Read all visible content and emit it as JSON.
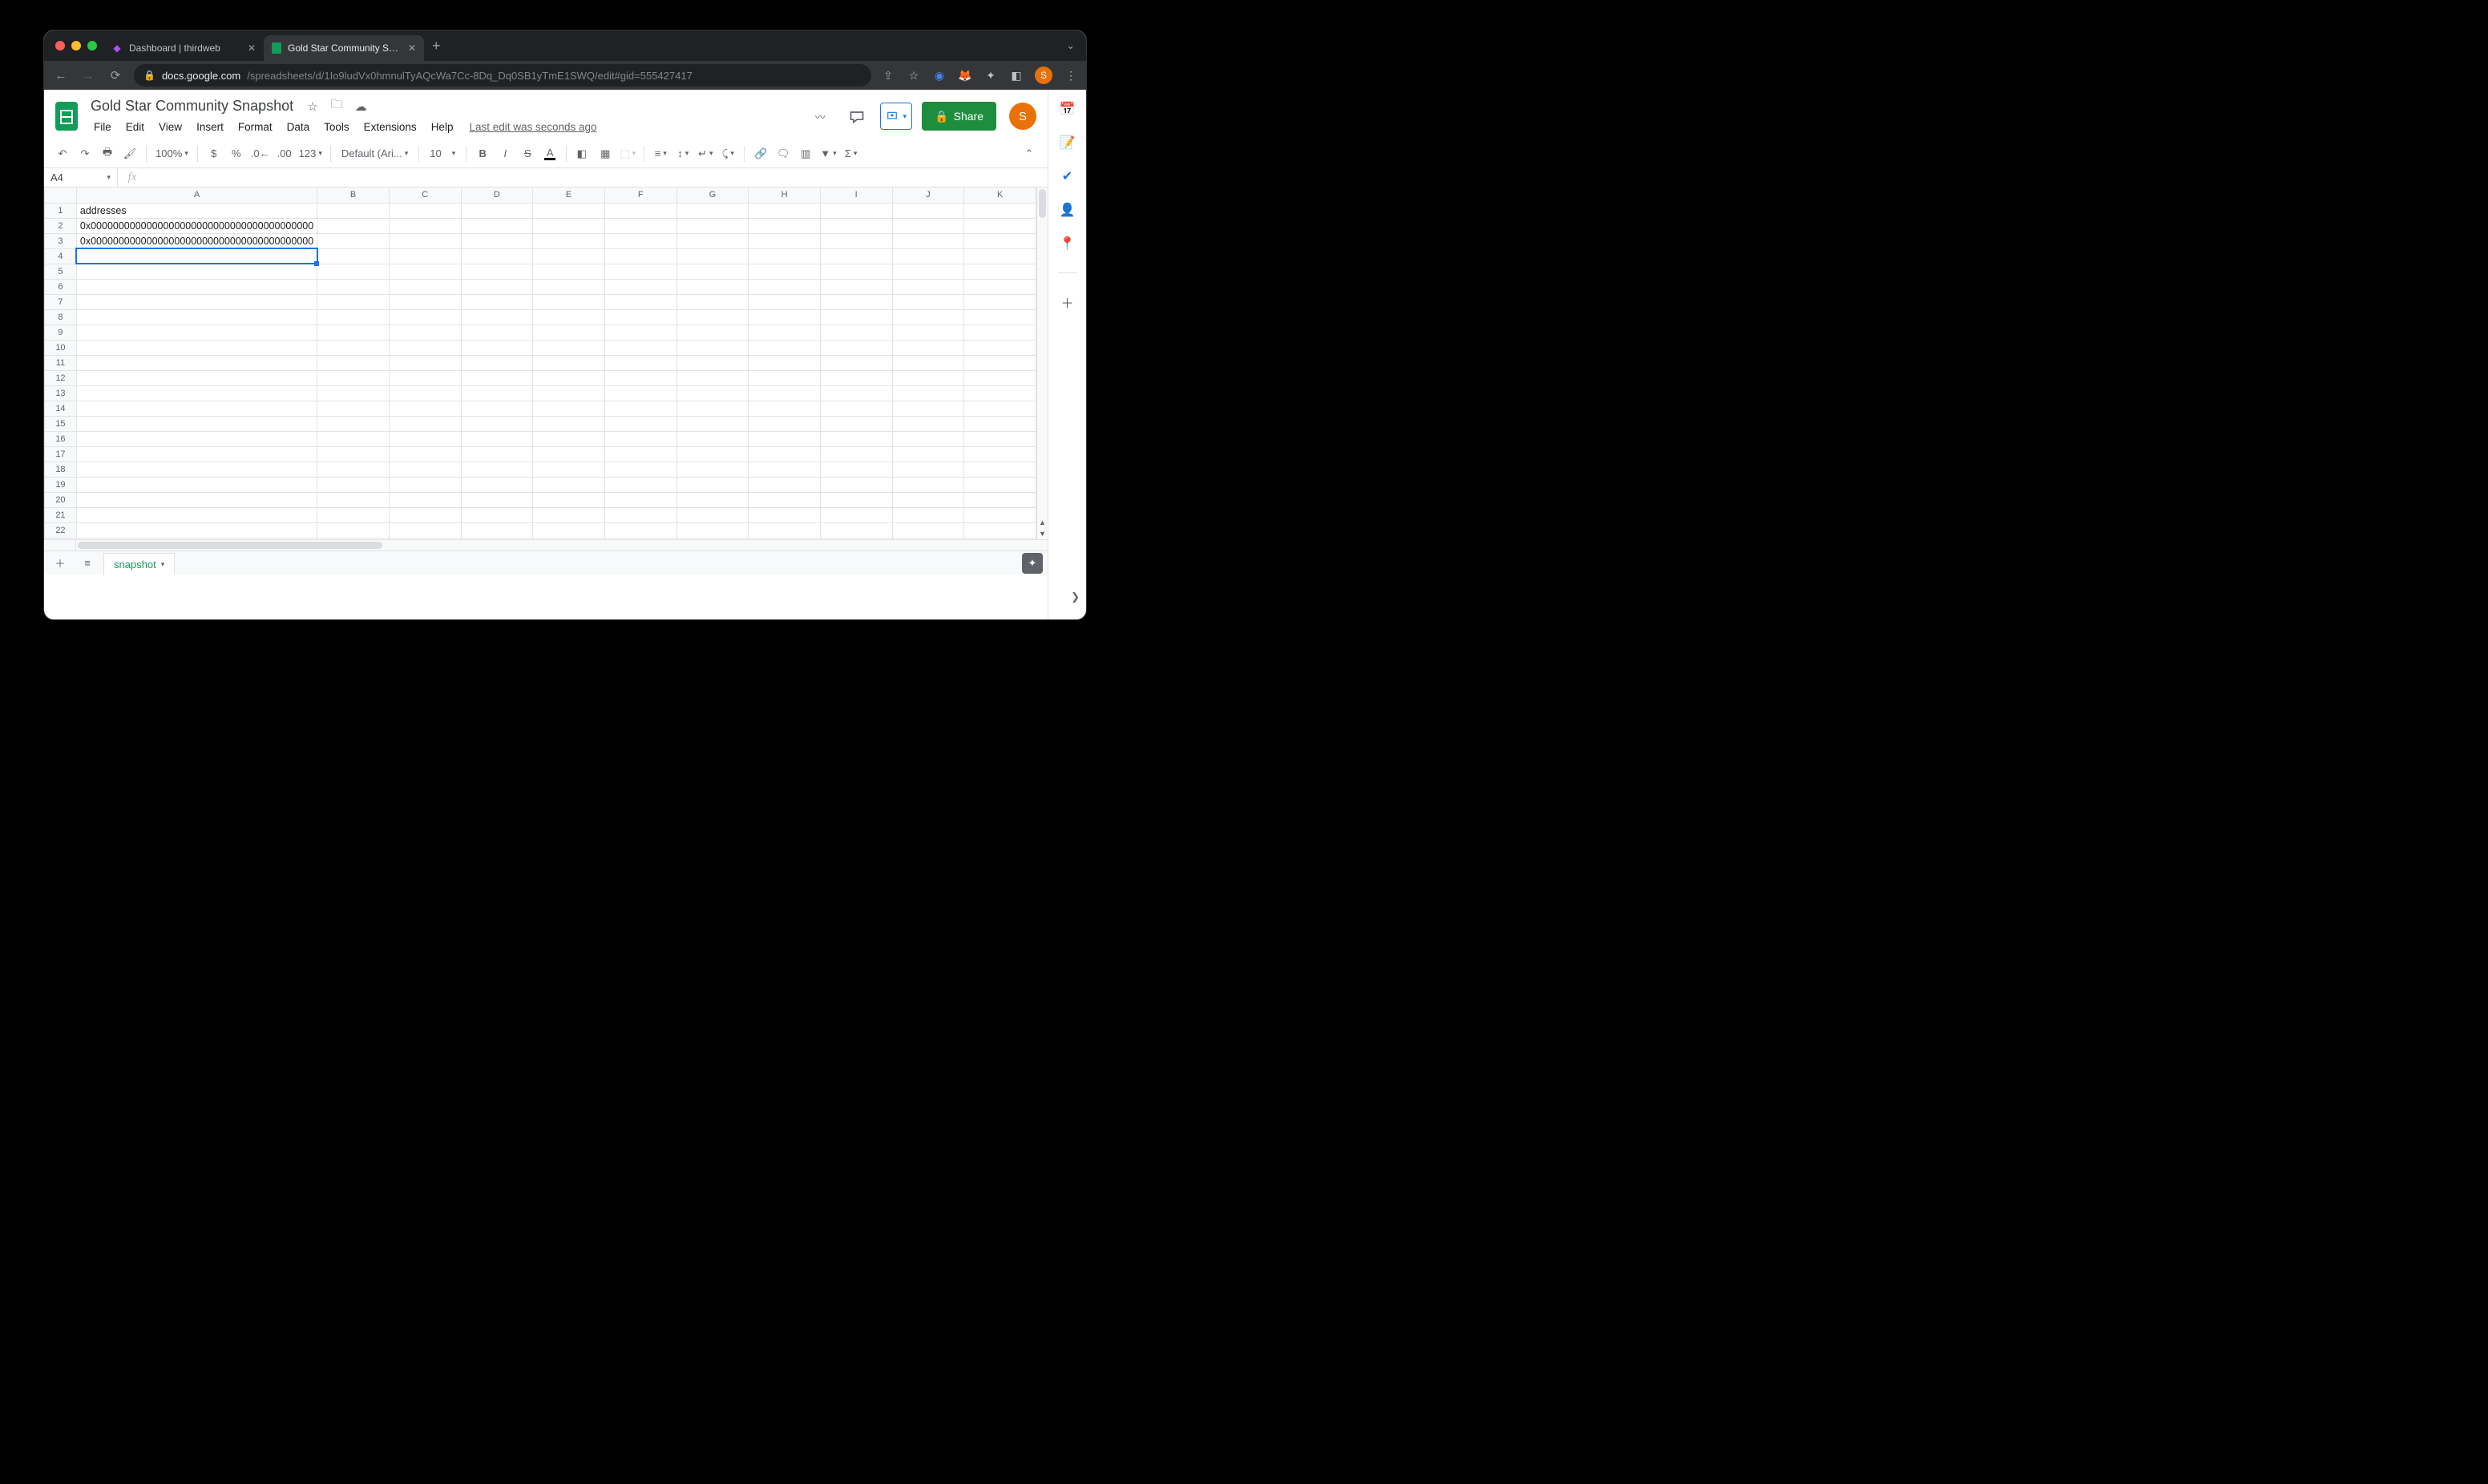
{
  "browser": {
    "tabs": [
      {
        "label": "Dashboard | thirdweb",
        "favicon_color": "#a855f7"
      },
      {
        "label": "Gold Star Community Snapsho",
        "favicon_color": "#0f9d58"
      }
    ],
    "url_prefix": "docs.google.com",
    "url_rest": "/spreadsheets/d/1Io9ludVx0hmnulTyAQcWa7Cc-8Dq_Dq0SB1yTmE1SWQ/edit#gid=555427417",
    "avatar_letter": "S"
  },
  "doc": {
    "title": "Gold Star Community Snapshot",
    "menus": [
      "File",
      "Edit",
      "View",
      "Insert",
      "Format",
      "Data",
      "Tools",
      "Extensions",
      "Help"
    ],
    "edit_info": "Last edit was seconds ago",
    "share_label": "Share"
  },
  "toolbar": {
    "zoom": "100%",
    "font": "Default (Ari...",
    "font_size": "10",
    "number_fmt": "123"
  },
  "fx": {
    "name_box": "A4",
    "formula": ""
  },
  "grid": {
    "columns": [
      "A",
      "B",
      "C",
      "D",
      "E",
      "F",
      "G",
      "H",
      "I",
      "J",
      "K"
    ],
    "row_count": 25,
    "selected": {
      "row": 4,
      "col": "A"
    },
    "cells": {
      "A1": "addresses",
      "A2": "0x0000000000000000000000000000000000000000",
      "A3": "0x0000000000000000000000000000000000000000"
    }
  },
  "sheet_tab": {
    "name": "snapshot"
  }
}
